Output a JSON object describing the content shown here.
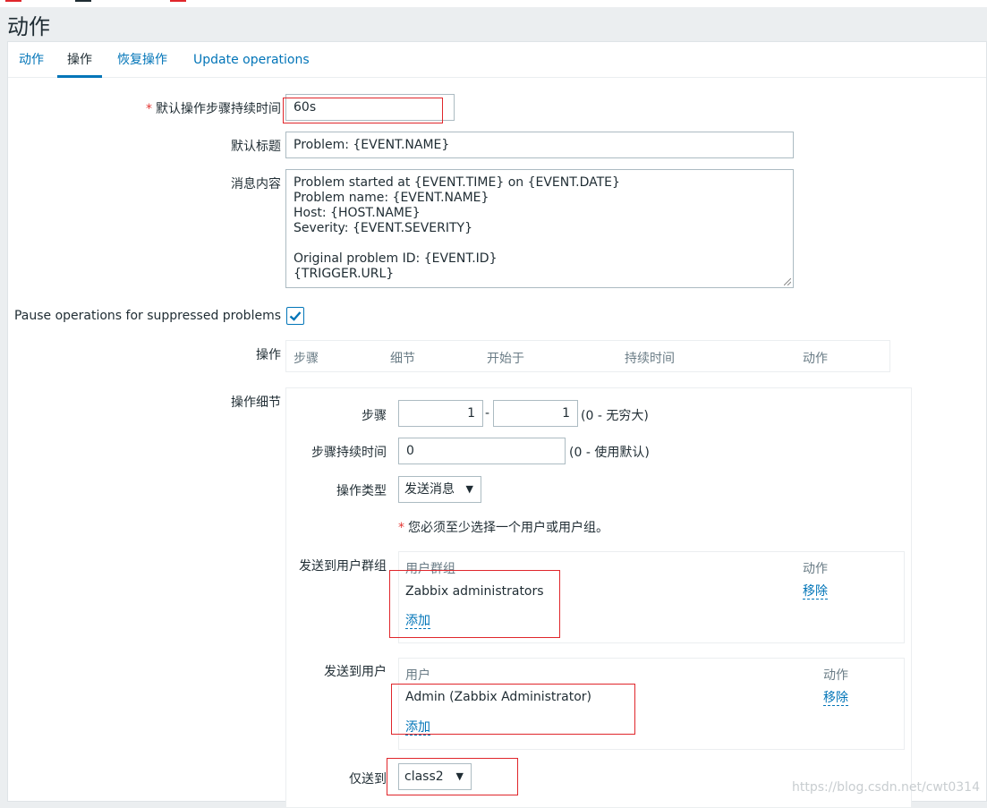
{
  "page": {
    "title": "动作"
  },
  "tabs": [
    "动作",
    "操作",
    "恢复操作",
    "Update operations"
  ],
  "form": {
    "default_duration": {
      "label": "默认操作步骤持续时间",
      "value": "60s"
    },
    "default_subject": {
      "label": "默认标题",
      "value": "Problem: {EVENT.NAME}"
    },
    "default_message": {
      "label": "消息内容",
      "lines": [
        "Problem started at {EVENT.TIME} on {EVENT.DATE}",
        "Problem name: {EVENT.NAME}",
        "Host: {HOST.NAME}",
        "Severity: {EVENT.SEVERITY}",
        "",
        "Original problem ID: {EVENT.ID}",
        "{TRIGGER.URL}"
      ]
    },
    "pause_suppressed": {
      "label": "Pause operations for suppressed problems",
      "checked": true
    },
    "operations": {
      "label": "操作",
      "columns": [
        "步骤",
        "细节",
        "开始于",
        "持续时间",
        "动作"
      ]
    },
    "op_details": {
      "label": "操作细节",
      "steps": {
        "label": "步骤",
        "from": "1",
        "sep": "-",
        "to": "1",
        "hint": "(0 - 无穷大)"
      },
      "step_duration": {
        "label": "步骤持续时间",
        "value": "0",
        "hint": "(0 - 使用默认)"
      },
      "op_type": {
        "label": "操作类型",
        "value": "发送消息"
      },
      "required_note": "您必须至少选择一个用户或用户组。",
      "send_to_groups": {
        "label": "发送到用户群组",
        "col_name": "用户群组",
        "col_action": "动作",
        "rows": [
          {
            "name": "Zabbix administrators",
            "action": "移除"
          }
        ],
        "add": "添加"
      },
      "send_to_users": {
        "label": "发送到用户",
        "col_name": "用户",
        "col_action": "动作",
        "rows": [
          {
            "name": "Admin (Zabbix Administrator)",
            "action": "移除"
          }
        ],
        "add": "添加"
      },
      "send_only_to": {
        "label": "仅送到",
        "value": "class2"
      }
    }
  },
  "watermark": "https://blog.csdn.net/cwt0314",
  "colors": {
    "accent": "#0275b8",
    "annotation": "#e0262b",
    "required": "#e33734"
  }
}
